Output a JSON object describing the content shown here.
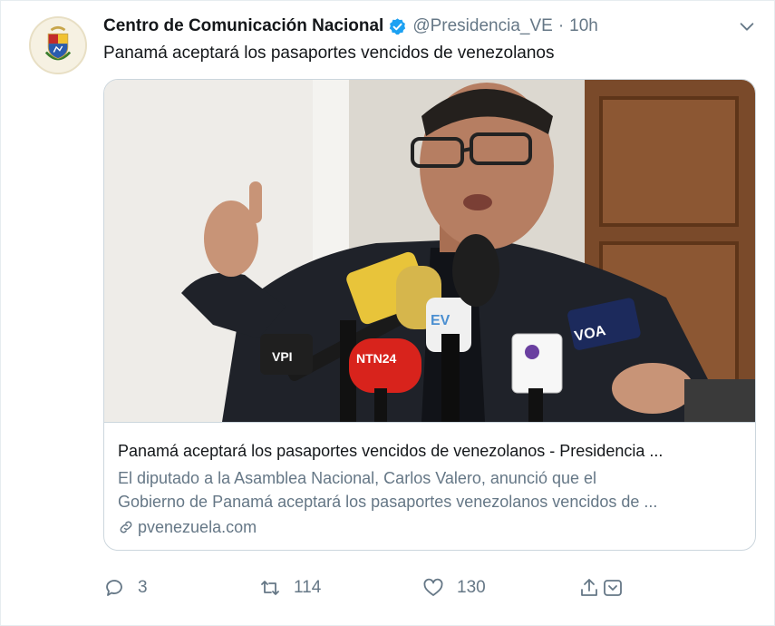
{
  "tweet": {
    "author_name": "Centro de Comunicación Nacional",
    "handle": "@Presidencia_VE",
    "separator": "·",
    "time": "10h",
    "text": "Panamá aceptará los pasaportes vencidos de venezolanos",
    "avatar_icon": "venezuela-coat-of-arms",
    "verified_icon": "verified-badge-icon",
    "caret_icon": "chevron-down-icon"
  },
  "card": {
    "title": "Panamá aceptará los pasaportes vencidos de venezolanos - Presidencia ...",
    "description_line1": "El diputado a la Asamblea Nacional, Carlos Valero, anunció que el",
    "description_line2": "Gobierno de Panamá aceptará los pasaportes venezolanos vencidos de ...",
    "domain": "pvenezuela.com",
    "image_mic_labels": {
      "vpi": "VPI",
      "ntn": "NTN24",
      "ev": "EV",
      "voa": "VOA"
    }
  },
  "actions": {
    "reply_count": "3",
    "retweet_count": "114",
    "like_count": "130",
    "reply_icon": "reply-icon",
    "retweet_icon": "retweet-icon",
    "like_icon": "heart-icon",
    "share_icon": "share-icon"
  },
  "colors": {
    "text_primary": "#14171a",
    "text_secondary": "#657786",
    "verified_blue": "#1da1f2",
    "border": "#ccd6dd"
  }
}
